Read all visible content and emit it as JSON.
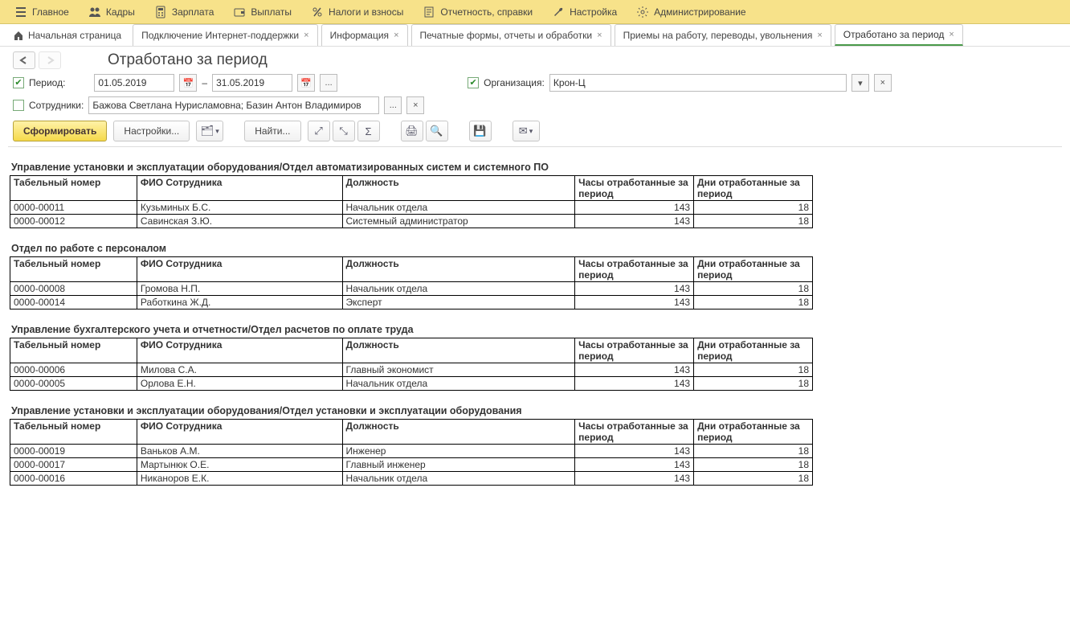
{
  "menu": [
    {
      "label": "Главное",
      "icon": "menu"
    },
    {
      "label": "Кадры",
      "icon": "people"
    },
    {
      "label": "Зарплата",
      "icon": "calc"
    },
    {
      "label": "Выплаты",
      "icon": "wallet"
    },
    {
      "label": "Налоги и взносы",
      "icon": "percent"
    },
    {
      "label": "Отчетность, справки",
      "icon": "doc"
    },
    {
      "label": "Настройка",
      "icon": "wrench"
    },
    {
      "label": "Администрирование",
      "icon": "gear"
    }
  ],
  "tabs": [
    {
      "label": "Начальная страница",
      "closable": false,
      "home": true
    },
    {
      "label": "Подключение Интернет-поддержки",
      "closable": true
    },
    {
      "label": "Информация",
      "closable": true
    },
    {
      "label": "Печатные формы, отчеты и обработки",
      "closable": true
    },
    {
      "label": "Приемы на работу, переводы, увольнения",
      "closable": true
    },
    {
      "label": "Отработано за период",
      "closable": true,
      "active": true
    }
  ],
  "page_title": "Отработано за период",
  "filters": {
    "period_label": "Период:",
    "date_from": "01.05.2019",
    "date_to": "31.05.2019",
    "dash": "–",
    "dots": "...",
    "org_label": "Организация:",
    "org_value": "Крон-Ц",
    "emp_label": "Сотрудники:",
    "emp_value": "Бажова Светлана Нурисламовна; Базин Антон Владимиров"
  },
  "toolbar": {
    "generate": "Сформировать",
    "settings": "Настройки...",
    "find": "Найти..."
  },
  "columns": {
    "tabno": "Табельный номер",
    "fio": "ФИО Сотрудника",
    "pos": "Должность",
    "hours": "Часы отработанные за период",
    "days": "Дни отработанные за период"
  },
  "report": [
    {
      "title": "Управление установки и эксплуатации оборудования/Отдел автоматизированных систем и системного ПО",
      "rows": [
        {
          "tabno": "0000-00011",
          "fio": "Кузьминых Б.С.",
          "pos": "Начальник отдела",
          "hours": "143",
          "days": "18"
        },
        {
          "tabno": "0000-00012",
          "fio": "Савинская З.Ю.",
          "pos": "Системный администратор",
          "hours": "143",
          "days": "18"
        }
      ]
    },
    {
      "title": "Отдел по работе с персоналом",
      "rows": [
        {
          "tabno": "0000-00008",
          "fio": "Громова Н.П.",
          "pos": "Начальник отдела",
          "hours": "143",
          "days": "18"
        },
        {
          "tabno": "0000-00014",
          "fio": "Работкина Ж.Д.",
          "pos": "Эксперт",
          "hours": "143",
          "days": "18"
        }
      ]
    },
    {
      "title": "Управление бухгалтерского учета и отчетности/Отдел расчетов по оплате труда",
      "rows": [
        {
          "tabno": "0000-00006",
          "fio": "Милова С.А.",
          "pos": "Главный экономист",
          "hours": "143",
          "days": "18"
        },
        {
          "tabno": "0000-00005",
          "fio": "Орлова Е.Н.",
          "pos": "Начальник отдела",
          "hours": "143",
          "days": "18"
        }
      ]
    },
    {
      "title": "Управление установки и эксплуатации оборудования/Отдел установки и эксплуатации оборудования",
      "rows": [
        {
          "tabno": "0000-00019",
          "fio": "Ваньков А.М.",
          "pos": "Инженер",
          "hours": "143",
          "days": "18"
        },
        {
          "tabno": "0000-00017",
          "fio": "Мартынюк О.Е.",
          "pos": "Главный инженер",
          "hours": "143",
          "days": "18"
        },
        {
          "tabno": "0000-00016",
          "fio": "Никаноров Е.К.",
          "pos": "Начальник отдела",
          "hours": "143",
          "days": "18"
        }
      ]
    }
  ]
}
